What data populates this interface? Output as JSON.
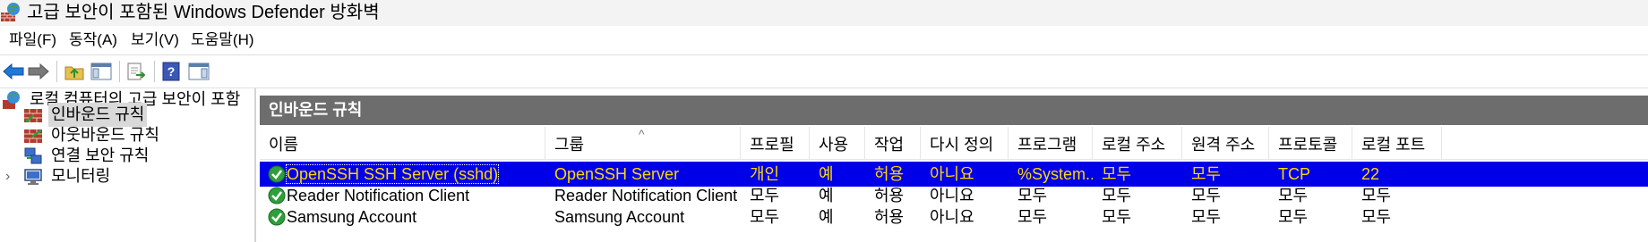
{
  "window": {
    "title": "고급 보안이 포함된 Windows Defender 방화벽",
    "icon": "firewall-globe-icon"
  },
  "menu": [
    "파일(F)",
    "동작(A)",
    "보기(V)",
    "도움말(H)"
  ],
  "toolbar": {
    "buttons": [
      "back-arrow-icon",
      "forward-arrow-icon",
      "up-folder-icon",
      "show-hide-console-tree-icon",
      "export-list-icon",
      "help-icon",
      "show-hide-action-pane-icon"
    ],
    "colors": {
      "arrow_blue": "#1e78d7",
      "arrow_gray": "#7a7a7a"
    }
  },
  "tree": {
    "root": "로컬 컴퓨터의 고급 보안이 포함",
    "items": [
      "인바운드 규칙",
      "아웃바운드 규칙",
      "연결 보안 규칙",
      "모니터링"
    ],
    "selected_index": 0
  },
  "panel": {
    "title": "인바운드 규칙",
    "columns": [
      "이름",
      "그룹",
      "프로필",
      "사용",
      "작업",
      "다시 정의",
      "프로그램",
      "로컬 주소",
      "원격 주소",
      "프로토콜",
      "로컬 포트"
    ],
    "sort_indicator": "^",
    "rows": [
      [
        "OpenSSH SSH Server (sshd)",
        "OpenSSH Server",
        "개인",
        "예",
        "허용",
        "아니요",
        "%System...",
        "모두",
        "모두",
        "TCP",
        "22"
      ],
      [
        "Reader Notification Client",
        "Reader Notification Client",
        "모두",
        "예",
        "허용",
        "아니요",
        "모두",
        "모두",
        "모두",
        "모두",
        "모두"
      ],
      [
        "Samsung Account",
        "Samsung Account",
        "모두",
        "예",
        "허용",
        "아니요",
        "모두",
        "모두",
        "모두",
        "모두",
        "모두"
      ]
    ],
    "selected_row": 0,
    "colors": {
      "selection": "#0000e8",
      "selected_text": "#ffd700",
      "enabled_check": "#2e9e3a",
      "header_bar": "#6d6d6d"
    }
  }
}
